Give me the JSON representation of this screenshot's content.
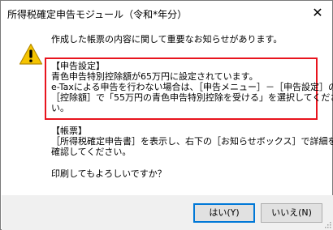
{
  "window": {
    "title": "所得税確定申告モジュール（令和*年分）",
    "close_glyph": "✕"
  },
  "icon": {
    "name": "warning-icon",
    "color": "#f5c400"
  },
  "message": {
    "intro": "作成した帳票の内容に関して重要なお知らせがあります。",
    "notice_heading": "【申告設定】",
    "notice_line1": "青色申告特別控除額が65万円に設定されています。",
    "notice_line2": "e-Taxによる申告を行わない場合は、［申告メニュー］－［申告設定］の",
    "notice_line3": "［控除額］で「55万円の青色申告特別控除を受ける」を選択してくださ",
    "notice_line4": "い。",
    "form_heading": "【帳票】",
    "form_line1": "［所得税確定申告書］を表示し、右下の［お知らせボックス］で詳細を",
    "form_line2": "確認してください。",
    "question": "印刷してもよろしいですか？"
  },
  "buttons": {
    "yes_label": "はい(Y)",
    "no_label": "いいえ(N)"
  },
  "colors": {
    "highlight_border": "#e8141e",
    "default_button_border": "#0078d7"
  }
}
